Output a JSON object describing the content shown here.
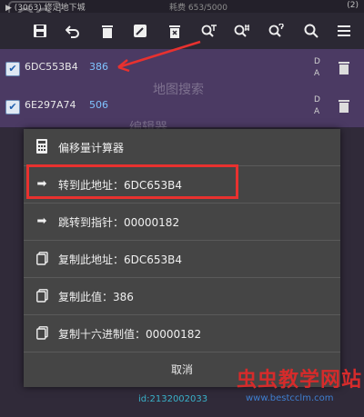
{
  "top_status": {
    "left": "▶ (3063)  修定地下城",
    "middle": "耗费 653/5000",
    "right": "(2)"
  },
  "toolbar_icons": [
    "save-icon",
    "undo-icon",
    "delete-icon",
    "edit-icon",
    "clear-icon",
    "search-text-icon",
    "search-hex-icon",
    "search-question-icon",
    "search-icon",
    "menu-icon"
  ],
  "list_items": [
    {
      "address": "6DC553B4",
      "value": "386",
      "flags": [
        "D",
        "A"
      ],
      "checked": true
    },
    {
      "address": "6E297A74",
      "value": "506",
      "flags": [
        "D",
        "A"
      ],
      "checked": true
    }
  ],
  "faded_background_text": {
    "behind_row1": "地图搜索",
    "behind_row2": "编辑器"
  },
  "context_menu": {
    "items": [
      {
        "icon": "calculator-icon",
        "label": "偏移量计算器"
      },
      {
        "icon": "arrow-right-icon",
        "label": "转到此地址：6DC653B4"
      },
      {
        "icon": "arrow-right-icon",
        "label": "跳转到指针：00000182"
      },
      {
        "icon": "copy-icon",
        "label": "复制此地址：6DC653B4"
      },
      {
        "icon": "copy-icon",
        "label": "复制此值：386"
      },
      {
        "icon": "copy-icon",
        "label": "复制十六进制值：00000182"
      }
    ],
    "cancel_label": "取消"
  },
  "annotations": {
    "id_text": "id:2132002033",
    "url_text": "www.bestcclm.com",
    "watermark": "虫虫教学网站",
    "highlight_color": "#e8312f"
  }
}
